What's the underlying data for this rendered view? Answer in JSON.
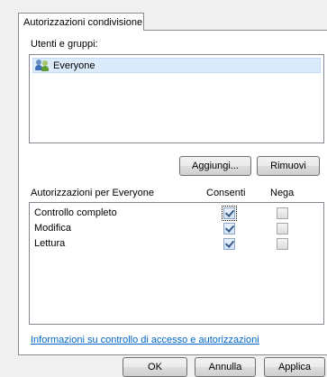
{
  "tab": {
    "label": "Autorizzazioni condivisione"
  },
  "users": {
    "label": "Utenti e gruppi:",
    "items": [
      {
        "name": "Everyone",
        "icon": "users-group-icon"
      }
    ]
  },
  "buttons": {
    "add": "Aggiungi...",
    "remove": "Rimuovi"
  },
  "permissions": {
    "label": "Autorizzazioni per Everyone",
    "allow_header": "Consenti",
    "deny_header": "Nega",
    "rows": [
      {
        "name": "Controllo completo",
        "allow": true,
        "deny": false
      },
      {
        "name": "Modifica",
        "allow": true,
        "deny": false
      },
      {
        "name": "Lettura",
        "allow": true,
        "deny": false
      }
    ]
  },
  "link": {
    "text": "Informazioni su controllo di accesso e autorizzazioni"
  },
  "footer": {
    "ok": "OK",
    "cancel": "Annulla",
    "apply": "Applica"
  }
}
